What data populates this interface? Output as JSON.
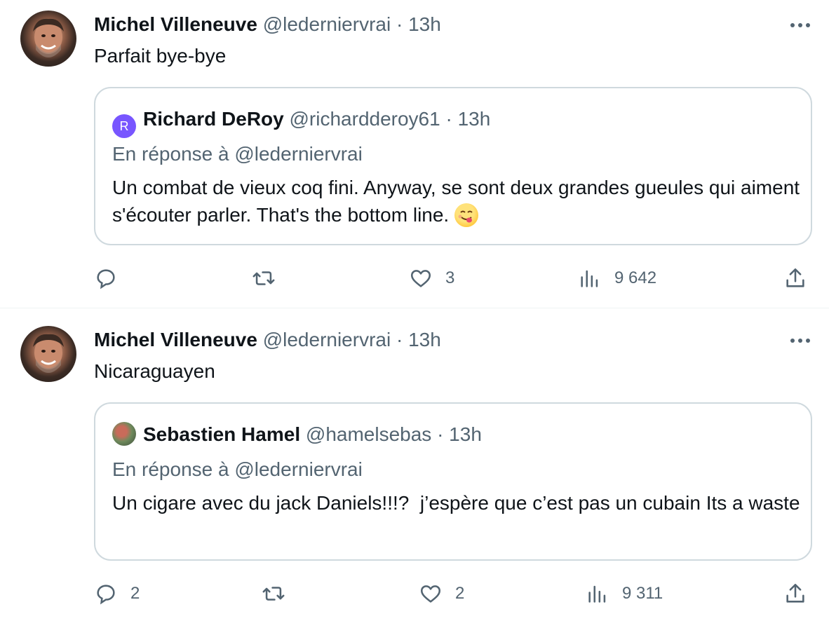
{
  "tweets": [
    {
      "author": "Michel Villeneuve",
      "meta": "@lederniervrai · 13h",
      "text": "Parfait bye-bye",
      "quote": {
        "author": "Richard DeRoy",
        "meta": "@richardderoy61 · 13h",
        "avatar_letter": "R",
        "avatar_color": "#7856ff",
        "reply_to": "En réponse à @lederniervrai",
        "text": "Un combat de vieux coq fini. Anyway, se sont deux grandes gueules qui aiment s'écouter parler. That's the bottom line."
      },
      "stats": {
        "replies": "",
        "retweets": "",
        "likes": "3",
        "views": "9 642"
      }
    },
    {
      "author": "Michel Villeneuve",
      "meta": "@lederniervrai · 13h",
      "text": "Nicaraguayen",
      "quote": {
        "author": "Sebastien Hamel",
        "meta": "@hamelsebas · 13h",
        "reply_to": "En réponse à @lederniervrai",
        "text": "Un cigare avec du jack Daniels!!!?  j’espère que c’est pas un cubain Its a waste"
      },
      "stats": {
        "replies": "2",
        "retweets": "",
        "likes": "2",
        "views": "9 311"
      }
    }
  ],
  "icons": {
    "reply": "reply-icon",
    "retweet": "retweet-icon",
    "like": "heart-icon",
    "views": "analytics-icon",
    "share": "share-icon",
    "more": "more-icon"
  },
  "colors": {
    "text": "#0f1419",
    "secondary": "#536471",
    "border": "#cfd9de"
  }
}
